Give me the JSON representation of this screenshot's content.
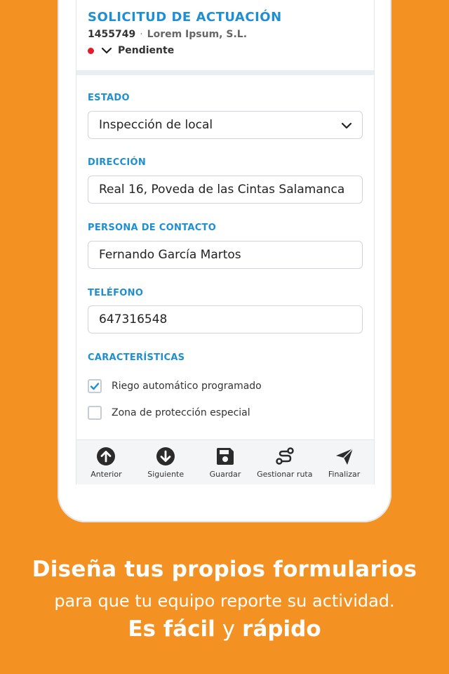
{
  "header": {
    "title": "SOLICITUD DE ACTUACIÓN",
    "number": "1455749",
    "separator": "·",
    "company": "Lorem Ipsum, S.L.",
    "status": "Pendiente",
    "status_color": "#E11D2A"
  },
  "form": {
    "estado": {
      "label": "ESTADO",
      "value": "Inspección de local"
    },
    "direccion": {
      "label": "DIRECCIÓN",
      "value": "Real 16, Poveda de las Cintas Salamanca"
    },
    "contacto": {
      "label": "PERSONA DE CONTACTO",
      "value": "Fernando García Martos"
    },
    "telefono": {
      "label": "TELÉFONO",
      "value": "647316548"
    },
    "caracteristicas": {
      "label": "CARACTERÍSTICAS",
      "options": [
        {
          "label": "Riego automático programado",
          "checked": true
        },
        {
          "label": "Zona de protección especial",
          "checked": false
        }
      ]
    }
  },
  "toolbar": {
    "items": [
      {
        "label": "Anterior",
        "icon": "arrow-up-circle-icon"
      },
      {
        "label": "Siguiente",
        "icon": "arrow-down-circle-icon"
      },
      {
        "label": "Guardar",
        "icon": "save-icon"
      },
      {
        "label": "Gestionar ruta",
        "icon": "route-icon"
      },
      {
        "label": "Finalizar",
        "icon": "send-icon"
      }
    ]
  },
  "caption": {
    "line1": "Diseña tus propios formularios",
    "line2": "para que tu equipo reporte su actividad.",
    "line3_a": "Es fácil",
    "line3_b": "y",
    "line3_c": "rápido"
  },
  "colors": {
    "background": "#F39122",
    "accent": "#1E8FD3",
    "status_dot": "#E11D2A"
  }
}
